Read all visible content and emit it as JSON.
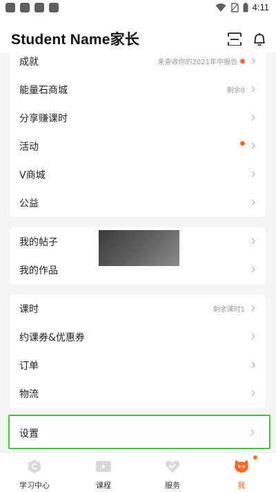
{
  "status_bar": {
    "time": "4:11"
  },
  "header": {
    "title": "Student Name家长",
    "icons": [
      "scan-icon",
      "bell-icon"
    ]
  },
  "sections": {
    "first": [
      {
        "label": "成就",
        "extra": "来查收你的2021年中报告",
        "dot": true
      },
      {
        "label": "能量石商城",
        "extra": "剩余0",
        "dot": false
      },
      {
        "label": "分享赚课时",
        "extra": "",
        "dot": false
      },
      {
        "label": "活动",
        "extra": "",
        "dot": true
      },
      {
        "label": "V商城",
        "extra": "",
        "dot": false
      },
      {
        "label": "公益",
        "extra": "",
        "dot": false
      }
    ],
    "second": [
      {
        "label": "我的帖子",
        "extra": ""
      },
      {
        "label": "我的作品",
        "extra": ""
      }
    ],
    "third": [
      {
        "label": "课时",
        "extra": "剩余课时1"
      },
      {
        "label": "约课券&优惠券",
        "extra": ""
      },
      {
        "label": "订单",
        "extra": ""
      },
      {
        "label": "物流",
        "extra": ""
      }
    ],
    "settings": {
      "label": "设置"
    }
  },
  "tabbar": {
    "tabs": [
      {
        "label": "学习中心",
        "icon": "learning-center-icon",
        "active": false
      },
      {
        "label": "课程",
        "icon": "course-play-icon",
        "active": false
      },
      {
        "label": "服务",
        "icon": "service-heart-icon",
        "active": false
      },
      {
        "label": "我",
        "icon": "me-cat-icon",
        "active": true
      }
    ]
  },
  "colors": {
    "accent": "#ff6a2b",
    "highlight_border": "#49c43c",
    "page_bg": "#f5f5f5"
  }
}
